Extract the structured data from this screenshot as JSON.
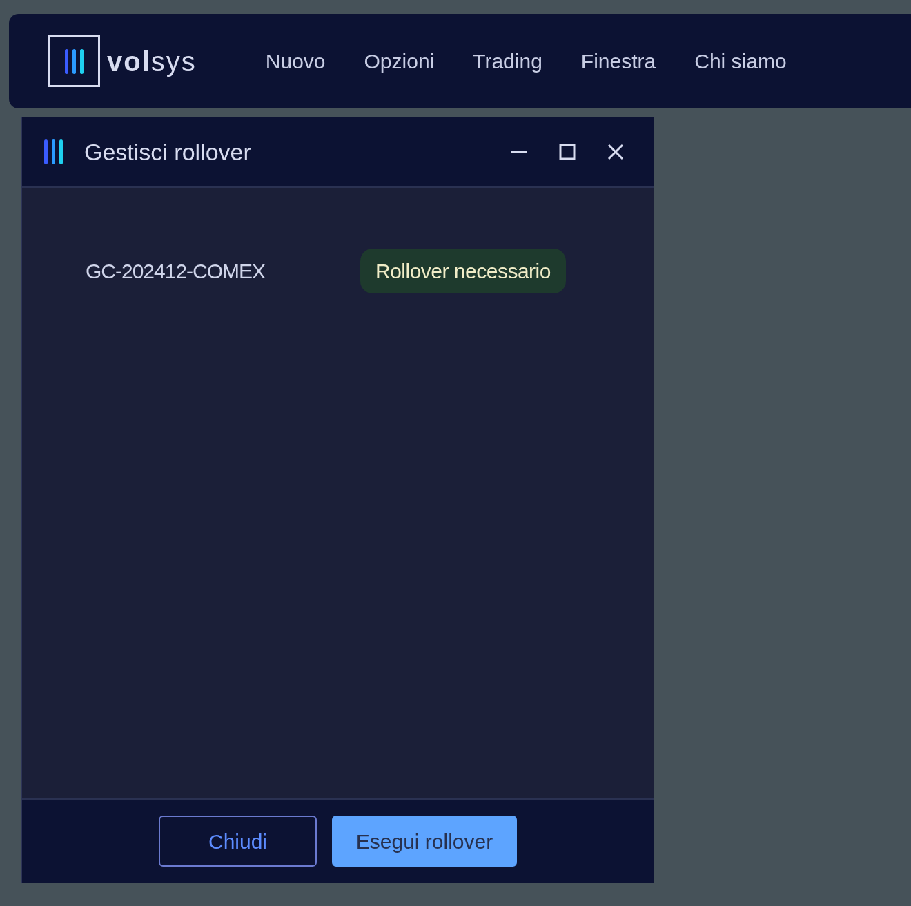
{
  "navbar": {
    "brand": "**vol**sys",
    "items": [
      "Nuovo",
      "Opzioni",
      "Trading",
      "Finestra",
      "Chi siamo"
    ]
  },
  "window": {
    "title": "Gestisci rollover",
    "contracts": [
      {
        "name": "GC-202412-COMEX",
        "status": "Rollover necessario",
        "color": "#1e3a2d"
      }
    ],
    "buttons": [
      {
        "label": "Chiudi",
        "kind": "outline"
      },
      {
        "label": "Esegui rollover",
        "kind": "primary"
      }
    ]
  }
}
